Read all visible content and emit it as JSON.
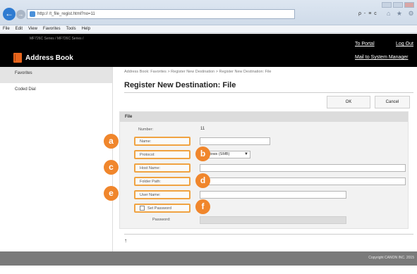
{
  "browser": {
    "url": "http://             /t_file_regist.html?no=11",
    "search_tools": "ρ - ≡ c",
    "nav_icons": "⌂ ★ ⚙",
    "menu": [
      "File",
      "Edit",
      "View",
      "Favorites",
      "Tools",
      "Help"
    ]
  },
  "header": {
    "device_name": "MF726C Series / MF726C Series /",
    "title": "Address Book",
    "to_portal": "To Portal",
    "log_out": "Log Out",
    "mail_to_sysmgr": "Mail to System Manager"
  },
  "sidebar": {
    "items": [
      {
        "label": "Favorites"
      },
      {
        "label": "Coded Dial"
      }
    ]
  },
  "main": {
    "breadcrumb": "Address Book: Favorites > Register New Destination > Register New Destination: File",
    "title": "Register New Destination: File",
    "ok_label": "OK",
    "cancel_label": "Cancel",
    "panel_title": "File",
    "number_label": "Number:",
    "number_value": "11",
    "name_label": "Name:",
    "name_value": "",
    "protocol_label": "Protocol:",
    "protocol_value": "Windows (SMB)",
    "host_label": "Host Name:",
    "host_value": "",
    "folder_label": "Folder Path:",
    "folder_value": "",
    "user_label": "User Name:",
    "user_value": "",
    "setpw_label": "Set Password",
    "password_label": "Password:",
    "password_value": "",
    "top_link": "↑"
  },
  "markers": {
    "a": "a",
    "b": "b",
    "c": "c",
    "d": "d",
    "e": "e",
    "f": "f"
  },
  "footer": {
    "copyright": "Copyright CANON INC. 2015"
  },
  "colors": {
    "accent_orange": "#f0862c",
    "label_border": "#f0a342",
    "header_bg": "#000000"
  }
}
